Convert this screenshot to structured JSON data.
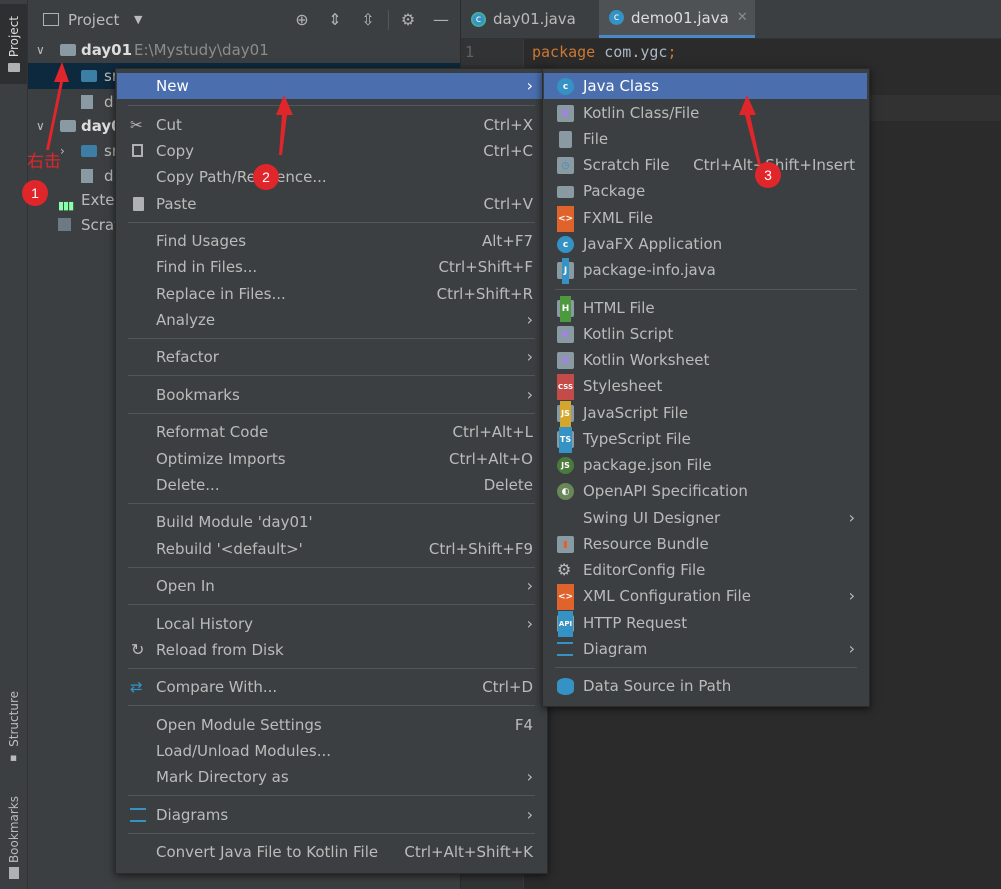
{
  "left_strip": {
    "project_tab": "Project",
    "structure_tab": "Structure",
    "bookmarks_tab": "Bookmarks"
  },
  "project_header": {
    "title": "Project"
  },
  "tree": {
    "root_name": "day01",
    "root_path": "E:\\Mystudy\\day01",
    "items": [
      "sr",
      "d",
      "day0",
      "sr",
      "d",
      "Exter",
      "Scrat"
    ]
  },
  "tabs": [
    {
      "label": "day01.java"
    },
    {
      "label": "demo01.java",
      "active": true
    }
  ],
  "editor": {
    "line_number": "1",
    "keyword": "package",
    "package_name": "com.ygc",
    "semicolon": ";"
  },
  "context_menu": {
    "items": [
      {
        "label": "New",
        "shortcut": "",
        "submenu": true
      },
      {
        "label": "Cut",
        "shortcut": "Ctrl+X"
      },
      {
        "label": "Copy",
        "shortcut": "Ctrl+C"
      },
      {
        "label": "Copy Path/Reference...",
        "shortcut": ""
      },
      {
        "label": "Paste",
        "shortcut": "Ctrl+V"
      },
      {
        "label": "Find Usages",
        "shortcut": "Alt+F7"
      },
      {
        "label": "Find in Files...",
        "shortcut": "Ctrl+Shift+F"
      },
      {
        "label": "Replace in Files...",
        "shortcut": "Ctrl+Shift+R"
      },
      {
        "label": "Analyze",
        "shortcut": "",
        "submenu": true
      },
      {
        "label": "Refactor",
        "shortcut": "",
        "submenu": true
      },
      {
        "label": "Bookmarks",
        "shortcut": "",
        "submenu": true
      },
      {
        "label": "Reformat Code",
        "shortcut": "Ctrl+Alt+L"
      },
      {
        "label": "Optimize Imports",
        "shortcut": "Ctrl+Alt+O"
      },
      {
        "label": "Delete...",
        "shortcut": "Delete"
      },
      {
        "label": "Build Module 'day01'",
        "shortcut": ""
      },
      {
        "label": "Rebuild '<default>'",
        "shortcut": "Ctrl+Shift+F9"
      },
      {
        "label": "Open In",
        "shortcut": "",
        "submenu": true
      },
      {
        "label": "Local History",
        "shortcut": "",
        "submenu": true
      },
      {
        "label": "Reload from Disk",
        "shortcut": ""
      },
      {
        "label": "Compare With...",
        "shortcut": "Ctrl+D"
      },
      {
        "label": "Open Module Settings",
        "shortcut": "F4"
      },
      {
        "label": "Load/Unload Modules...",
        "shortcut": ""
      },
      {
        "label": "Mark Directory as",
        "shortcut": "",
        "submenu": true
      },
      {
        "label": "Diagrams",
        "shortcut": "",
        "submenu": true
      },
      {
        "label": "Convert Java File to Kotlin File",
        "shortcut": "Ctrl+Alt+Shift+K"
      }
    ]
  },
  "new_submenu": {
    "items": [
      {
        "label": "Java Class",
        "shortcut": ""
      },
      {
        "label": "Kotlin Class/File",
        "shortcut": ""
      },
      {
        "label": "File",
        "shortcut": ""
      },
      {
        "label": "Scratch File",
        "shortcut": "Ctrl+Alt+Shift+Insert"
      },
      {
        "label": "Package",
        "shortcut": ""
      },
      {
        "label": "FXML File",
        "shortcut": ""
      },
      {
        "label": "JavaFX Application",
        "shortcut": ""
      },
      {
        "label": "package-info.java",
        "shortcut": ""
      },
      {
        "label": "HTML File",
        "shortcut": ""
      },
      {
        "label": "Kotlin Script",
        "shortcut": ""
      },
      {
        "label": "Kotlin Worksheet",
        "shortcut": ""
      },
      {
        "label": "Stylesheet",
        "shortcut": ""
      },
      {
        "label": "JavaScript File",
        "shortcut": ""
      },
      {
        "label": "TypeScript File",
        "shortcut": ""
      },
      {
        "label": "package.json File",
        "shortcut": ""
      },
      {
        "label": "OpenAPI Specification",
        "shortcut": ""
      },
      {
        "label": "Swing UI Designer",
        "shortcut": "",
        "submenu": true
      },
      {
        "label": "Resource Bundle",
        "shortcut": ""
      },
      {
        "label": "EditorConfig File",
        "shortcut": ""
      },
      {
        "label": "XML Configuration File",
        "shortcut": "",
        "submenu": true
      },
      {
        "label": "HTTP Request",
        "shortcut": ""
      },
      {
        "label": "Diagram",
        "shortcut": "",
        "submenu": true
      },
      {
        "label": "Data Source in Path",
        "shortcut": ""
      }
    ]
  },
  "annotations": {
    "right_click_text": "右击",
    "badge1": "1",
    "badge2": "2",
    "badge3": "3"
  },
  "colors": {
    "highlight": "#4b6eaf",
    "annotation_red": "#e0262b",
    "keyword": "#cc7832",
    "bg": "#2b2b2b",
    "panel": "#3c3f41"
  }
}
